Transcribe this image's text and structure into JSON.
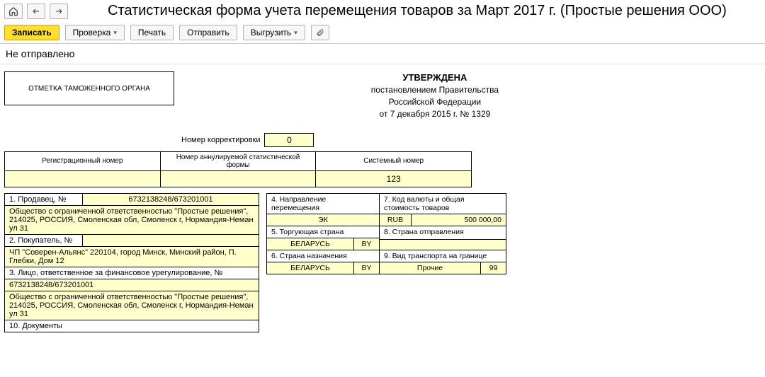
{
  "header": {
    "title": "Статистическая форма учета перемещения товаров за Март 2017 г. (Простые решения ООО)"
  },
  "toolbar": {
    "save": "Записать",
    "check": "Проверка",
    "print": "Печать",
    "send": "Отправить",
    "export": "Выгрузить"
  },
  "status": "Не отправлено",
  "approved": {
    "line1": "УТВЕРЖДЕНА",
    "line2": "постановлением Правительства",
    "line3": "Российской Федерации",
    "line4": "от 7 декабря 2015 г. № 1329"
  },
  "stamp_label": "ОТМЕТКА ТАМОЖЕННОГО ОРГАНА",
  "correction": {
    "label": "Номер корректировки",
    "value": "0"
  },
  "reg_table": {
    "hdr_reg": "Регистрационный номер",
    "hdr_annul": "Номер аннулируемой статистической формы",
    "hdr_sys": "Системный номер",
    "val_reg": "",
    "val_annul": "",
    "val_sys": "123"
  },
  "left": {
    "r1_hdr": "1. Продавец, №",
    "r1_num": "6732138248/673201001",
    "r1_body": "Общество с ограниченной ответственностью \"Простые решения\", 214025, РОССИЯ, Смоленская обл, Смоленск г, Нормандия-Неман ул 31",
    "r2_hdr": "2. Покупатель, №",
    "r2_body": "ЧП \"Соверен-Альянс\"  220104, город Минск, Минский район, П. Глебки, Дом 12",
    "r3_hdr": "3. Лицо, ответственное за финансовое урегулирование, №",
    "r3_num": "6732138248/673201001",
    "r3_body": "Общество с ограниченной ответственностью \"Простые решения\", 214025, РОССИЯ, Смоленская обл, Смоленск г, Нормандия-Неман ул 31",
    "r10_hdr": "10. Документы"
  },
  "right": {
    "r4_hdr": "4. Направление перемещения",
    "r4_val": "ЭК",
    "r5_hdr": "5. Торгующая страна",
    "r5_val": "БЕЛАРУСЬ",
    "r5_code": "BY",
    "r6_hdr": "6. Страна назначения",
    "r6_val": "БЕЛАРУСЬ",
    "r6_code": "BY",
    "r7_hdr": "7. Код валюты и общая стоимость товаров",
    "r7_cur": "RUB",
    "r7_sum": "500 000,00",
    "r8_hdr": "8. Страна отправления",
    "r9_hdr": "9. Вид транспорта на границе",
    "r9_val": "Прочие",
    "r9_code": "99"
  }
}
